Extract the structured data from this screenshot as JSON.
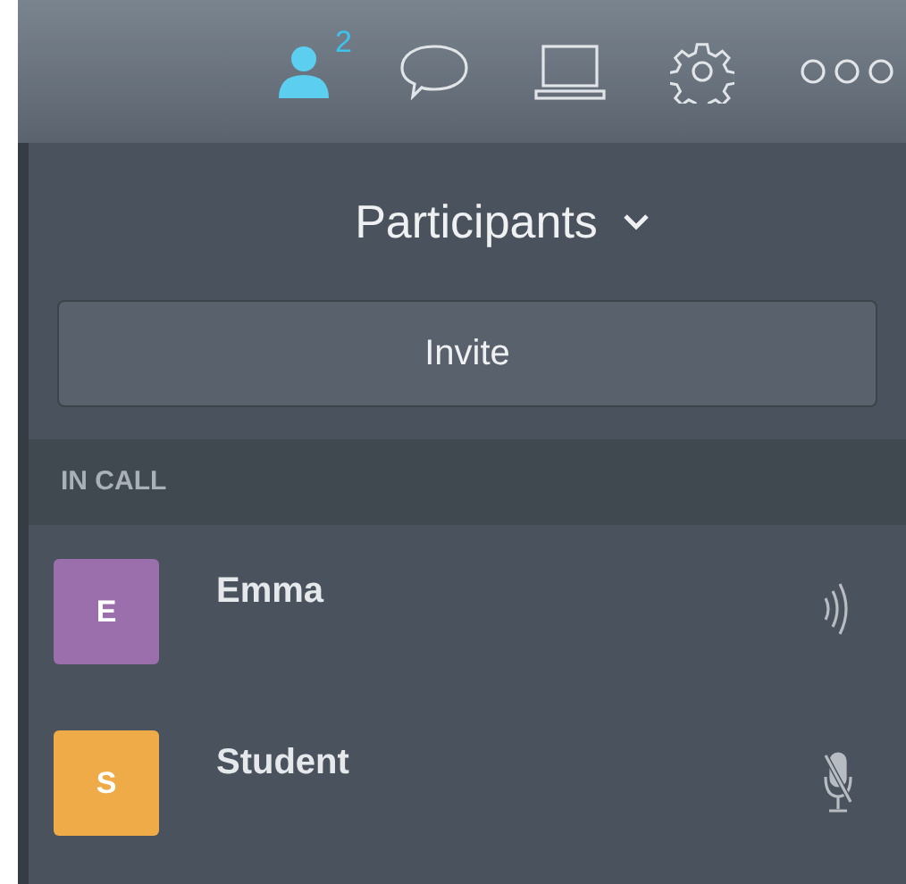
{
  "toolbar": [
    {
      "kind": "participants",
      "selected": true,
      "badge": "2"
    },
    {
      "kind": "chat",
      "selected": false
    },
    {
      "kind": "screen",
      "selected": false
    },
    {
      "kind": "settings",
      "selected": false
    },
    {
      "kind": "more",
      "selected": false
    }
  ],
  "panel": {
    "title": "Participants",
    "invite_button": "Invite",
    "section": "IN CALL",
    "participants": [
      {
        "initial": "E",
        "name": "Emma",
        "color": "#9b6fac",
        "kind": "speaking"
      },
      {
        "initial": "S",
        "name": "Student",
        "color": "#eeab47",
        "kind": "muted"
      }
    ]
  }
}
